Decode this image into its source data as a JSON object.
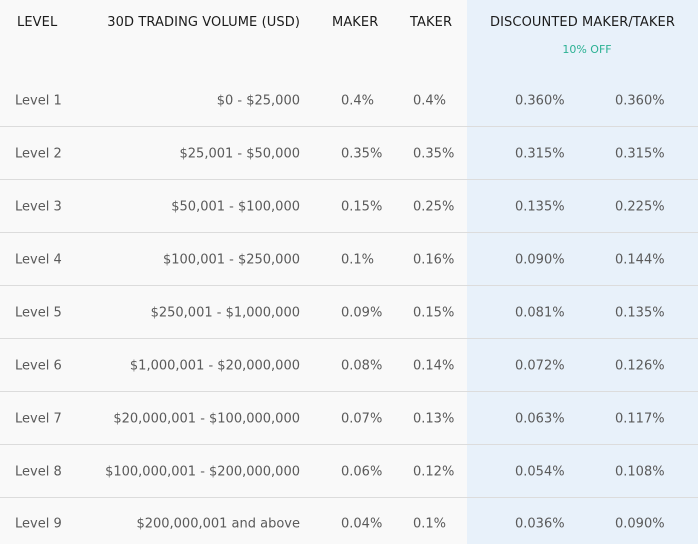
{
  "header": {
    "level": "LEVEL",
    "volume": "30D TRADING VOLUME (USD)",
    "maker": "MAKER",
    "taker": "TAKER",
    "discounted": "DISCOUNTED MAKER/TAKER",
    "discount_badge": "10% OFF"
  },
  "colors": {
    "discount_column_bg": "#e8f1fa",
    "discount_badge": "#2bb193",
    "divider": "#dcdcdc"
  },
  "rows": [
    {
      "level": "Level 1",
      "volume": "$0 - $25,000",
      "maker": "0.4%",
      "taker": "0.4%",
      "d_maker": "0.360%",
      "d_taker": "0.360%"
    },
    {
      "level": "Level 2",
      "volume": "$25,001 - $50,000",
      "maker": "0.35%",
      "taker": "0.35%",
      "d_maker": "0.315%",
      "d_taker": "0.315%"
    },
    {
      "level": "Level 3",
      "volume": "$50,001 - $100,000",
      "maker": "0.15%",
      "taker": "0.25%",
      "d_maker": "0.135%",
      "d_taker": "0.225%"
    },
    {
      "level": "Level 4",
      "volume": "$100,001 - $250,000",
      "maker": "0.1%",
      "taker": "0.16%",
      "d_maker": "0.090%",
      "d_taker": "0.144%"
    },
    {
      "level": "Level 5",
      "volume": "$250,001 - $1,000,000",
      "maker": "0.09%",
      "taker": "0.15%",
      "d_maker": "0.081%",
      "d_taker": "0.135%"
    },
    {
      "level": "Level 6",
      "volume": "$1,000,001 - $20,000,000",
      "maker": "0.08%",
      "taker": "0.14%",
      "d_maker": "0.072%",
      "d_taker": "0.126%"
    },
    {
      "level": "Level 7",
      "volume": "$20,000,001 - $100,000,000",
      "maker": "0.07%",
      "taker": "0.13%",
      "d_maker": "0.063%",
      "d_taker": "0.117%"
    },
    {
      "level": "Level 8",
      "volume": "$100,000,001 - $200,000,000",
      "maker": "0.06%",
      "taker": "0.12%",
      "d_maker": "0.054%",
      "d_taker": "0.108%"
    },
    {
      "level": "Level 9",
      "volume": "$200,000,001 and above",
      "maker": "0.04%",
      "taker": "0.1%",
      "d_maker": "0.036%",
      "d_taker": "0.090%"
    }
  ]
}
